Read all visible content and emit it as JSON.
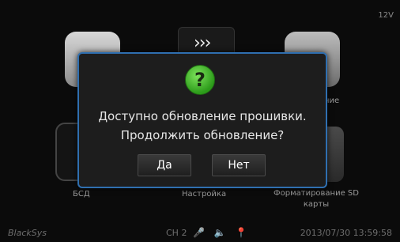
{
  "header": {
    "voltage": "12V"
  },
  "menu": {
    "items": [
      {
        "label": "БСД"
      },
      {
        "label": "Настройка"
      },
      {
        "label": "Форматирование SD карты"
      }
    ],
    "partial_label_right": "ние"
  },
  "dialog": {
    "line1": "Доступно обновление прошивки.",
    "line2": "Продолжить обновление?",
    "yes_label": "Да",
    "no_label": "Нет"
  },
  "status": {
    "brand": "BlackSys",
    "channel": "CH 2",
    "datetime": "2013/07/30 13:59:58"
  },
  "colors": {
    "accent": "#2f6fb0",
    "question": "#4cc236"
  },
  "icons": [
    "camera-icon",
    "film-icon",
    "question-icon",
    "mic-icon",
    "speaker-icon",
    "gps-icon"
  ]
}
